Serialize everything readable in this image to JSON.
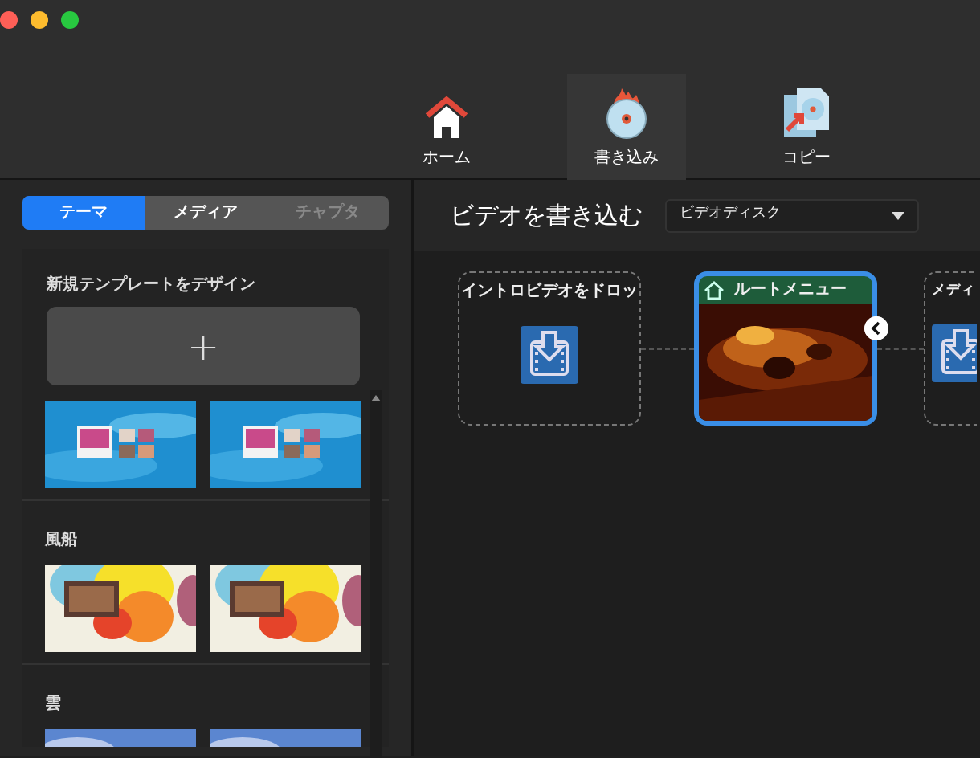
{
  "window": {
    "controls": [
      {
        "color": "#fe5f57"
      },
      {
        "color": "#febc2e"
      },
      {
        "color": "#28c840"
      }
    ]
  },
  "toolbar": [
    {
      "label": "ホーム",
      "kind": "home",
      "selected": false
    },
    {
      "label": "書き込み",
      "kind": "burn",
      "selected": true
    },
    {
      "label": "コピー",
      "kind": "copy",
      "selected": false
    }
  ],
  "sidebar": {
    "tabs": [
      {
        "label": "テーマ",
        "selected": true,
        "disabled": false
      },
      {
        "label": "メディア",
        "selected": false,
        "disabled": false
      },
      {
        "label": "チャプタ",
        "selected": false,
        "disabled": true
      }
    ],
    "new_template": {
      "label": "新規テンプレートをデザイン",
      "button": "+"
    },
    "groups": [
      {
        "thumbnails": [
          {
            "kind": "picture"
          },
          {
            "kind": "picture"
          }
        ]
      },
      {
        "name": "風船",
        "thumbnails": [
          {
            "kind": "picture"
          },
          {
            "kind": "picture"
          }
        ]
      },
      {
        "name": "雲",
        "thumbnails": [
          {
            "kind": "picture"
          },
          {
            "kind": "picture"
          }
        ]
      }
    ]
  },
  "main": {
    "title": "ビデオを書き込む",
    "disc_type": "ビデオディスク",
    "nodes": [
      {
        "kind": "drop",
        "label": "イントロビデオをドロッ"
      },
      {
        "kind": "menu",
        "label": "ルートメニュー",
        "selected": true
      },
      {
        "kind": "drop",
        "label": "メディ"
      }
    ]
  }
}
